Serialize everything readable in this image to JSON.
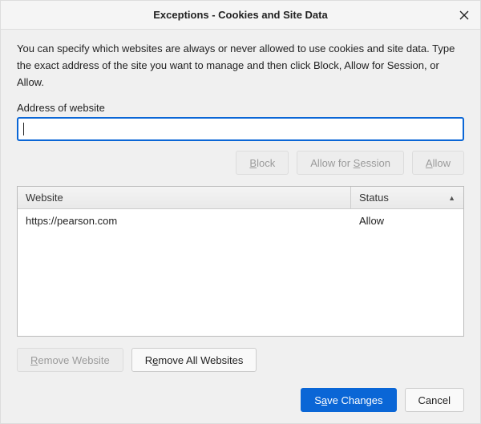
{
  "titlebar": {
    "title": "Exceptions - Cookies and Site Data"
  },
  "description": "You can specify which websites are always or never allowed to use cookies and site data. Type the exact address of the site you want to manage and then click Block, Allow for Session, or Allow.",
  "field": {
    "label": "Address of website",
    "value": ""
  },
  "buttons": {
    "block_pre": "",
    "block_u": "B",
    "block_post": "lock",
    "afs_pre": "Allow for ",
    "afs_u": "S",
    "afs_post": "ession",
    "allow_pre": "",
    "allow_u": "A",
    "allow_post": "llow",
    "remove_pre": "",
    "remove_u": "R",
    "remove_post": "emove Website",
    "removeall_pre": "R",
    "removeall_u": "e",
    "removeall_post": "move All Websites",
    "save_pre": "S",
    "save_u": "a",
    "save_post": "ve Changes",
    "cancel": "Cancel"
  },
  "table": {
    "columns": {
      "website": "Website",
      "status": "Status"
    },
    "rows": [
      {
        "website": "https://pearson.com",
        "status": "Allow"
      }
    ]
  }
}
